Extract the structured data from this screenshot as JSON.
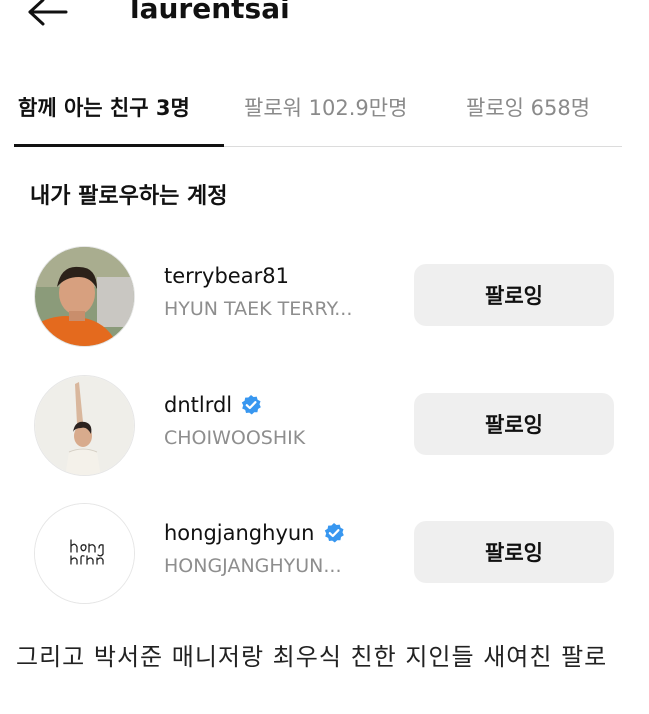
{
  "header": {
    "title": "laurentsai",
    "back_icon": "arrow-left-icon"
  },
  "tabs": [
    {
      "label": "함께 아는 친구 3명",
      "active": true
    },
    {
      "label": "팔로워 102.9만명",
      "active": false
    },
    {
      "label": "팔로잉 658명",
      "active": false
    }
  ],
  "section": {
    "title": "내가 팔로우하는 계정"
  },
  "accounts": [
    {
      "username": "terrybear81",
      "fullname": "HYUN TAEK TERRY...",
      "verified": false,
      "button_label": "팔로잉"
    },
    {
      "username": "dntlrdl",
      "fullname": "CHOIWOOSHIK",
      "verified": true,
      "button_label": "팔로잉"
    },
    {
      "username": "hongjanghyun",
      "fullname": "HONGJANGHYUN...",
      "verified": true,
      "button_label": "팔로잉"
    }
  ],
  "caption": "그리고 박서준 매니저랑 최우식 친한 지인들 새여친 팔로",
  "colors": {
    "verified_badge": "#3897f0",
    "button_bg": "#efefef",
    "secondary_text": "#8e8e8e"
  }
}
